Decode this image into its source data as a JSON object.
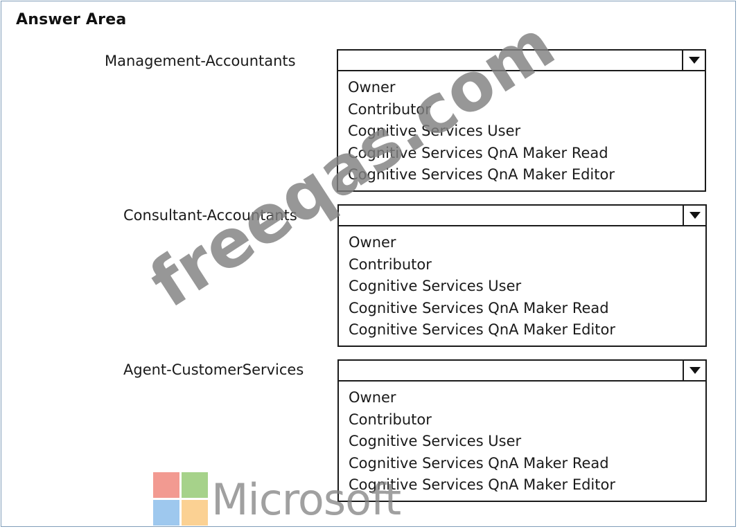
{
  "header": {
    "title": "Answer Area"
  },
  "rows": [
    {
      "label": "Management-Accountants",
      "selected": "",
      "options": [
        "Owner",
        "Contributor",
        "Cognitive Services User",
        "Cognitive Services QnA Maker Read",
        "Cognitive Services QnA Maker Editor"
      ]
    },
    {
      "label": "Consultant-Accountants",
      "selected": "",
      "options": [
        "Owner",
        "Contributor",
        "Cognitive Services User",
        "Cognitive Services QnA Maker Read",
        "Cognitive Services QnA Maker Editor"
      ]
    },
    {
      "label": "Agent-CustomerServices",
      "selected": "",
      "options": [
        "Owner",
        "Contributor",
        "Cognitive Services User",
        "Cognitive Services QnA Maker Read",
        "Cognitive Services QnA Maker Editor"
      ]
    }
  ],
  "watermark": {
    "text": "freeqas.com",
    "logo_text": "Microsoft",
    "logo_colors": [
      "#f29a91",
      "#a6d28a",
      "#9ec8ee",
      "#fbd193"
    ]
  },
  "icons": {
    "dropdown_arrow": "triangle-down-icon",
    "logo": "microsoft-logo-icon"
  }
}
